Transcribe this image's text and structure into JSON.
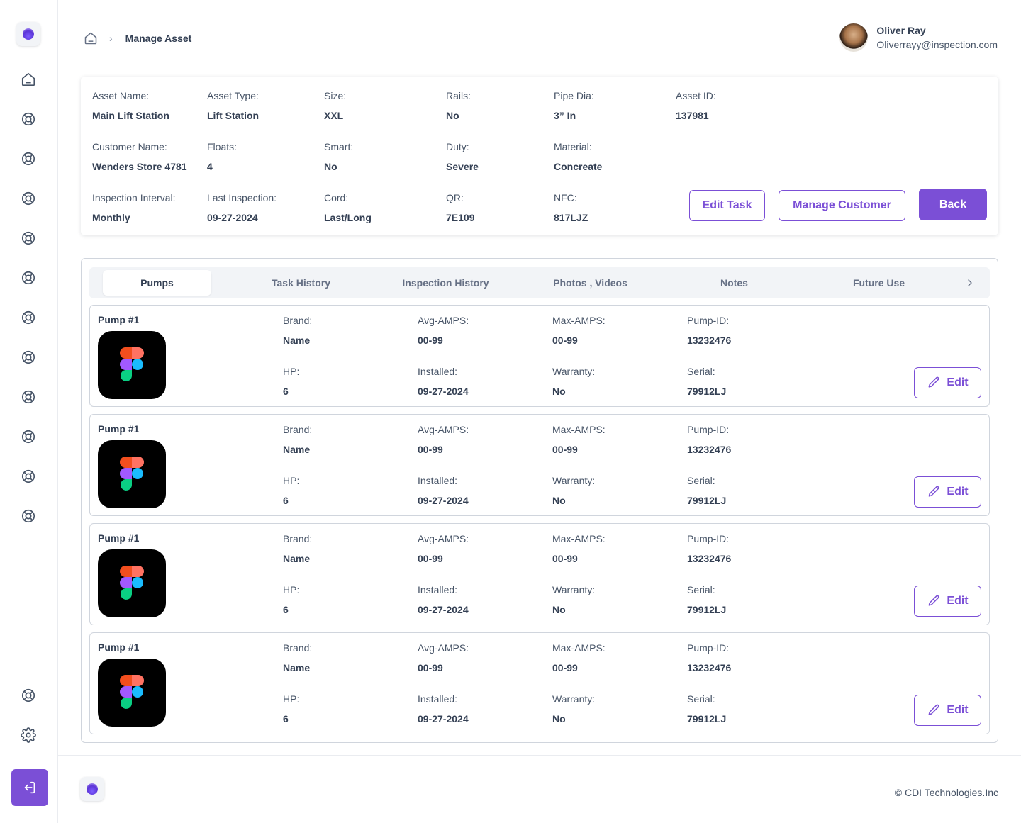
{
  "breadcrumb": {
    "current": "Manage Asset"
  },
  "user": {
    "name": "Oliver Ray",
    "email": "Oliverrayy@inspection.com"
  },
  "asset": {
    "asset_name_label": "Asset Name:",
    "asset_name": "Main Lift Station",
    "asset_type_label": "Asset Type:",
    "asset_type": "Lift Station",
    "size_label": "Size:",
    "size": "XXL",
    "rails_label": "Rails:",
    "rails": "No",
    "pipe_dia_label": "Pipe Dia:",
    "pipe_dia": "3” In",
    "asset_id_label": "Asset ID:",
    "asset_id": "137981",
    "customer_name_label": "Customer Name:",
    "customer_name": "Wenders Store 4781",
    "floats_label": "Floats:",
    "floats": "4",
    "smart_label": "Smart:",
    "smart": "No",
    "duty_label": "Duty:",
    "duty": "Severe",
    "material_label": "Material:",
    "material": "Concreate",
    "inspection_interval_label": "Inspection Interval:",
    "inspection_interval": "Monthly",
    "last_inspection_label": "Last Inspection:",
    "last_inspection": "09-27-2024",
    "cord_label": "Cord:",
    "cord": "Last/Long",
    "qr_label": "QR:",
    "qr": "7E109",
    "nfc_label": "NFC:",
    "nfc": "817LJZ"
  },
  "actions": {
    "edit_task": "Edit Task",
    "manage_customer": "Manage Customer",
    "back": "Back"
  },
  "tabs": [
    {
      "label": "Pumps",
      "active": true
    },
    {
      "label": "Task History"
    },
    {
      "label": "Inspection History"
    },
    {
      "label": "Photos , Videos"
    },
    {
      "label": "Notes"
    },
    {
      "label": "Future Use"
    }
  ],
  "pump_labels": {
    "brand": "Brand:",
    "avg_amps": "Avg-AMPS:",
    "max_amps": "Max-AMPS:",
    "pump_id": "Pump-ID:",
    "hp": "HP:",
    "installed": "Installed:",
    "warranty": "Warranty:",
    "serial": "Serial:",
    "edit": "Edit"
  },
  "pumps": [
    {
      "title": "Pump #1",
      "brand": "Name",
      "avg_amps": "00-99",
      "max_amps": "00-99",
      "pump_id": "13232476",
      "hp": "6",
      "installed": "09-27-2024",
      "warranty": "No",
      "serial": "79912LJ"
    },
    {
      "title": "Pump #1",
      "brand": "Name",
      "avg_amps": "00-99",
      "max_amps": "00-99",
      "pump_id": "13232476",
      "hp": "6",
      "installed": "09-27-2024",
      "warranty": "No",
      "serial": "79912LJ"
    },
    {
      "title": "Pump #1",
      "brand": "Name",
      "avg_amps": "00-99",
      "max_amps": "00-99",
      "pump_id": "13232476",
      "hp": "6",
      "installed": "09-27-2024",
      "warranty": "No",
      "serial": "79912LJ"
    },
    {
      "title": "Pump #1",
      "brand": "Name",
      "avg_amps": "00-99",
      "max_amps": "00-99",
      "pump_id": "13232476",
      "hp": "6",
      "installed": "09-27-2024",
      "warranty": "No",
      "serial": "79912LJ"
    }
  ],
  "footer": {
    "copyright": "© CDI Technologies.Inc"
  },
  "icons": {
    "nav": [
      "home-icon",
      "lifebuoy-icon",
      "settings-icon",
      "logout-icon"
    ],
    "pump_image": "figma-logo-icon",
    "edit": "pencil-icon"
  },
  "colors": {
    "accent": "#7b4fd6"
  }
}
